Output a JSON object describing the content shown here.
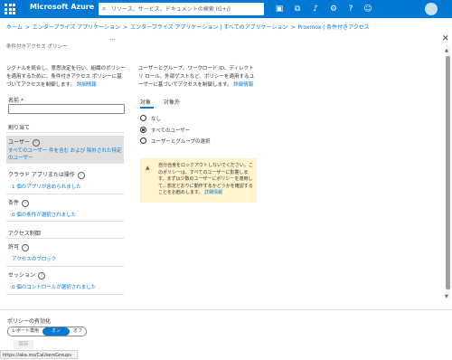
{
  "topbar": {
    "brand": "Microsoft Azure",
    "search_placeholder": "リソース、サービス、ドキュメントの検索 (G+/)",
    "icons": [
      "terminal-icon",
      "directory-filter-icon",
      "bell-icon",
      "gear-icon",
      "help-icon",
      "feedback-icon"
    ]
  },
  "breadcrumb": {
    "items": [
      "ホーム",
      "エンタープライズ アプリケーション",
      "エンタープライズ アプリケーション | すべてのアプリケーション",
      "Proxmox | 条件付きアクセス"
    ],
    "separator": ">"
  },
  "page": {
    "subtitle": "条件付きアクセス ポリシー",
    "ellipsis": "..."
  },
  "left": {
    "description": "シグナルを統合し、意思決定を行い、組織のポリシーを適用するために、条件付きアクセス ポリシーに基づいてアクセスを制御します。",
    "description_link": "詳細情報",
    "name_label": "名前",
    "name_required": "*",
    "name_value": "",
    "assignments_heading": "割り当て",
    "users_title": "ユーザー",
    "users_value": "すべてのユーザー 件を含む および 除外された特定のユーザー",
    "cloud_apps_title": "クラウド アプリまたは操作",
    "cloud_apps_value": "1 個のアプリが含められました",
    "conditions_title": "条件",
    "conditions_value": "0 個の条件が選択されました",
    "access_controls_heading": "アクセス制御",
    "grant_title": "許可",
    "grant_value": "アクセスのブロック",
    "session_title": "セッション",
    "session_value": "0 個のコントロールが選択されました"
  },
  "right": {
    "description": "ユーザーとグループ、ワークロード ID、ディレクトリ ロール、外部ゲストなど、ポリシーを適用するユーザーに基づいてアクセスを制御します。",
    "description_link": "詳細情報",
    "tabs": [
      "対象",
      "対象外"
    ],
    "radio_options": [
      "なし",
      "すべてのユーザー",
      "ユーザーとグループの選択"
    ],
    "selected_option": "すべてのユーザー",
    "warning_text": "自分自身をロックアウトしないでください。このポリシーは、すべてのユーザーに影響します。まずは少数のユーザーにポリシーを適用して、想定どおりに動作するかどうかを確認することをお勧めします。",
    "warning_link": "詳細情報"
  },
  "footer": {
    "enable_label": "ポリシーの有効化",
    "toggle_options": [
      "レポート専用",
      "オン",
      "オフ"
    ],
    "toggle_selected": "オン",
    "save_label": "保存"
  },
  "status_url": "https://aka.ms/CaUsersGroups",
  "colors": {
    "accent": "#0078d4",
    "warning_bg": "#fff4ce",
    "selected_block": "#e1dfdd"
  }
}
